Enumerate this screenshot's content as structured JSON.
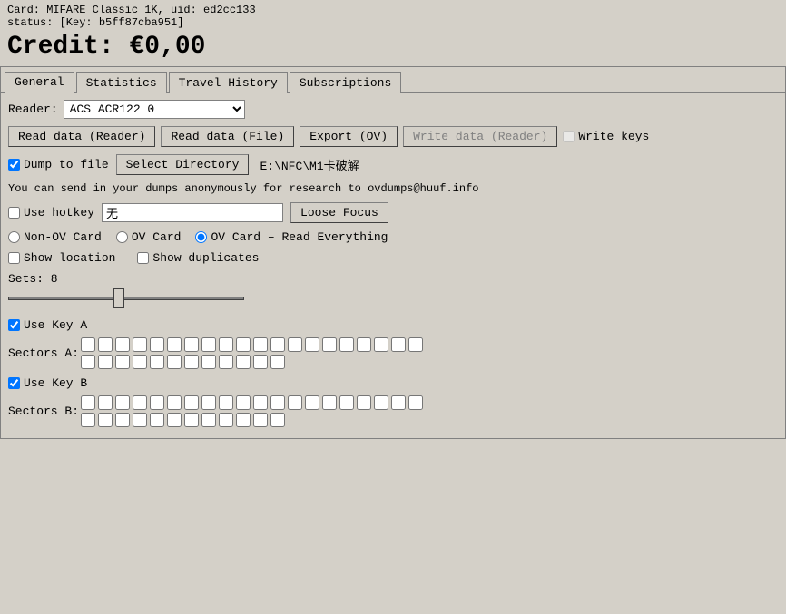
{
  "top_info": {
    "card_line": "Card: MIFARE Classic 1K, uid: ed2cc133",
    "status_line": "status: [Key: b5ff87cba951]"
  },
  "credit": {
    "label": "Credit: €0,00"
  },
  "tabs": [
    {
      "id": "general",
      "label": "General",
      "active": true
    },
    {
      "id": "statistics",
      "label": "Statistics",
      "active": false
    },
    {
      "id": "travel_history",
      "label": "Travel History",
      "active": false
    },
    {
      "id": "subscriptions",
      "label": "Subscriptions",
      "active": false
    }
  ],
  "reader_row": {
    "label": "Reader:",
    "value": "ACS ACR122 0"
  },
  "buttons": {
    "read_reader": "Read data (Reader)",
    "read_file": "Read data (File)",
    "export_ov": "Export (OV)",
    "write_reader": "Write data (Reader)",
    "write_keys": "Write keys"
  },
  "dump_row": {
    "checkbox_label": "Dump to file",
    "select_dir_label": "Select Directory",
    "path": "E:\\NFC\\M1卡破解"
  },
  "info_text": "You can send in your dumps anonymously for research to ovdumps@huuf.info",
  "hotkey_row": {
    "checkbox_label": "Use hotkey",
    "input_value": "无",
    "loose_focus_btn": "Loose Focus"
  },
  "radio_group": {
    "options": [
      {
        "id": "non_ov",
        "label": "Non-OV Card",
        "checked": false
      },
      {
        "id": "ov",
        "label": "OV Card",
        "checked": false
      },
      {
        "id": "ov_read_all",
        "label": "OV Card – Read Everything",
        "checked": true
      }
    ]
  },
  "show_row": {
    "show_location": "Show location",
    "show_duplicates": "Show duplicates"
  },
  "sets_row": {
    "label": "Sets: 8"
  },
  "slider": {
    "value": 8,
    "min": 1,
    "max": 16
  },
  "key_a": {
    "checkbox_label": "Use Key A",
    "sectors_label": "Sectors A:",
    "row1_count": 20,
    "row2_count": 12
  },
  "key_b": {
    "checkbox_label": "Use Key B",
    "sectors_label": "Sectors B:",
    "row1_count": 20,
    "row2_count": 12
  }
}
